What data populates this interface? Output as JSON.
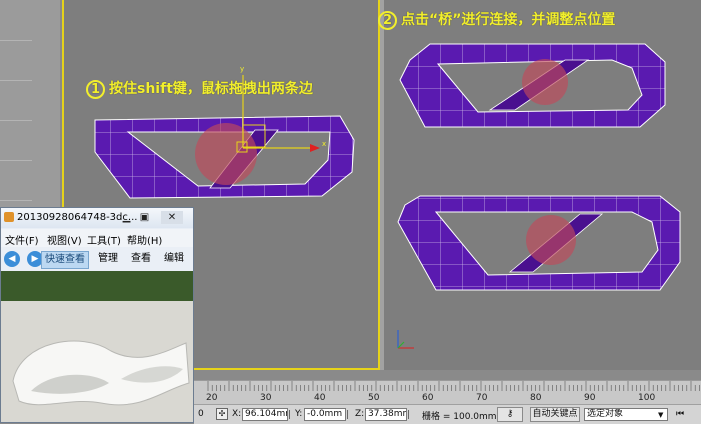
{
  "captions": {
    "step1_num": "1",
    "step1_text": "按住shift键，鼠标拖拽出两条边",
    "step2_num": "2",
    "step2_text": "点击“桥”进行连接，并调整点位置"
  },
  "gizmo": {
    "axis_y": "y",
    "axis_x": "x"
  },
  "timeline": {
    "ticks": [
      "20",
      "30",
      "40",
      "50",
      "60",
      "70",
      "80",
      "90",
      "100"
    ]
  },
  "status": {
    "x_label": "X:",
    "x_value": "96.104mm",
    "y_label": "Y:",
    "y_value": "-0.0mm",
    "z_label": "Z:",
    "z_value": "37.38mm",
    "grid_text": "栅格 = 100.0mm",
    "autokey": "自动关键点",
    "selection": "选定对象",
    "left_number": "0"
  },
  "viewer": {
    "title": "20130928064748-3dc...",
    "menu": [
      "文件(F)",
      "视图(V)",
      "工具(T)",
      "帮助(H)"
    ],
    "toolbar": {
      "quickview": "快速查看",
      "manage": "管理",
      "view": "查看",
      "edit": "编辑"
    }
  },
  "colors": {
    "mesh": "#5a1ab0",
    "mesh_edge": "#ffffff",
    "highlight": "#c04a5a",
    "caption": "#f2ef2c",
    "viewport_border": "#e6d31a"
  }
}
